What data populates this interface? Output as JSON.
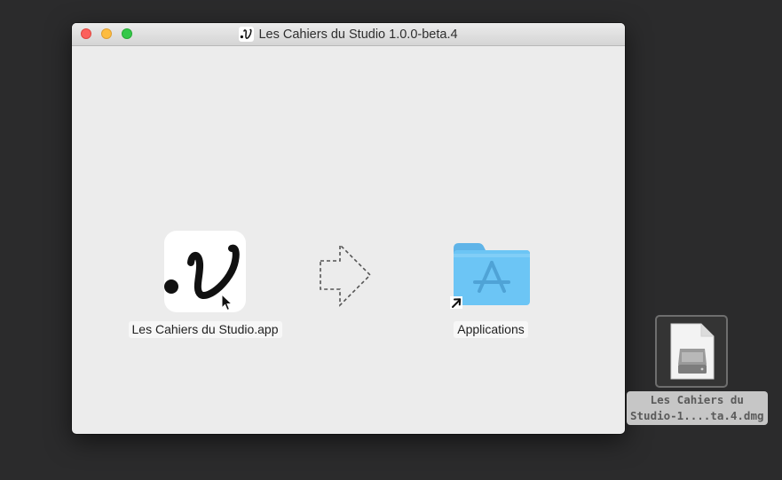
{
  "window": {
    "title": "Les Cahiers du Studio 1.0.0-beta.4",
    "title_icon": "app-proxy-icon",
    "buttons": {
      "close": "close-button",
      "minimize": "minimize-button",
      "zoom": "zoom-button"
    }
  },
  "installer": {
    "app": {
      "label": "Les Cahiers du Studio.app",
      "icon": "app-icon"
    },
    "arrow": "drag-arrow-icon",
    "applications": {
      "label": "Applications",
      "icon": "applications-folder-icon",
      "alias_badge": "alias-arrow-icon"
    }
  },
  "desktop": {
    "dmg": {
      "label_line1": "Les Cahiers du",
      "label_line2": "Studio-1....ta.4.dmg",
      "icon": "disk-image-icon"
    }
  },
  "colors": {
    "desktop_bg": "#2b2b2c",
    "window_bg": "#ececec",
    "close": "#fc605c",
    "minimize": "#fdbc40",
    "zoom": "#34c84a",
    "folder": "#6cc5f5"
  }
}
